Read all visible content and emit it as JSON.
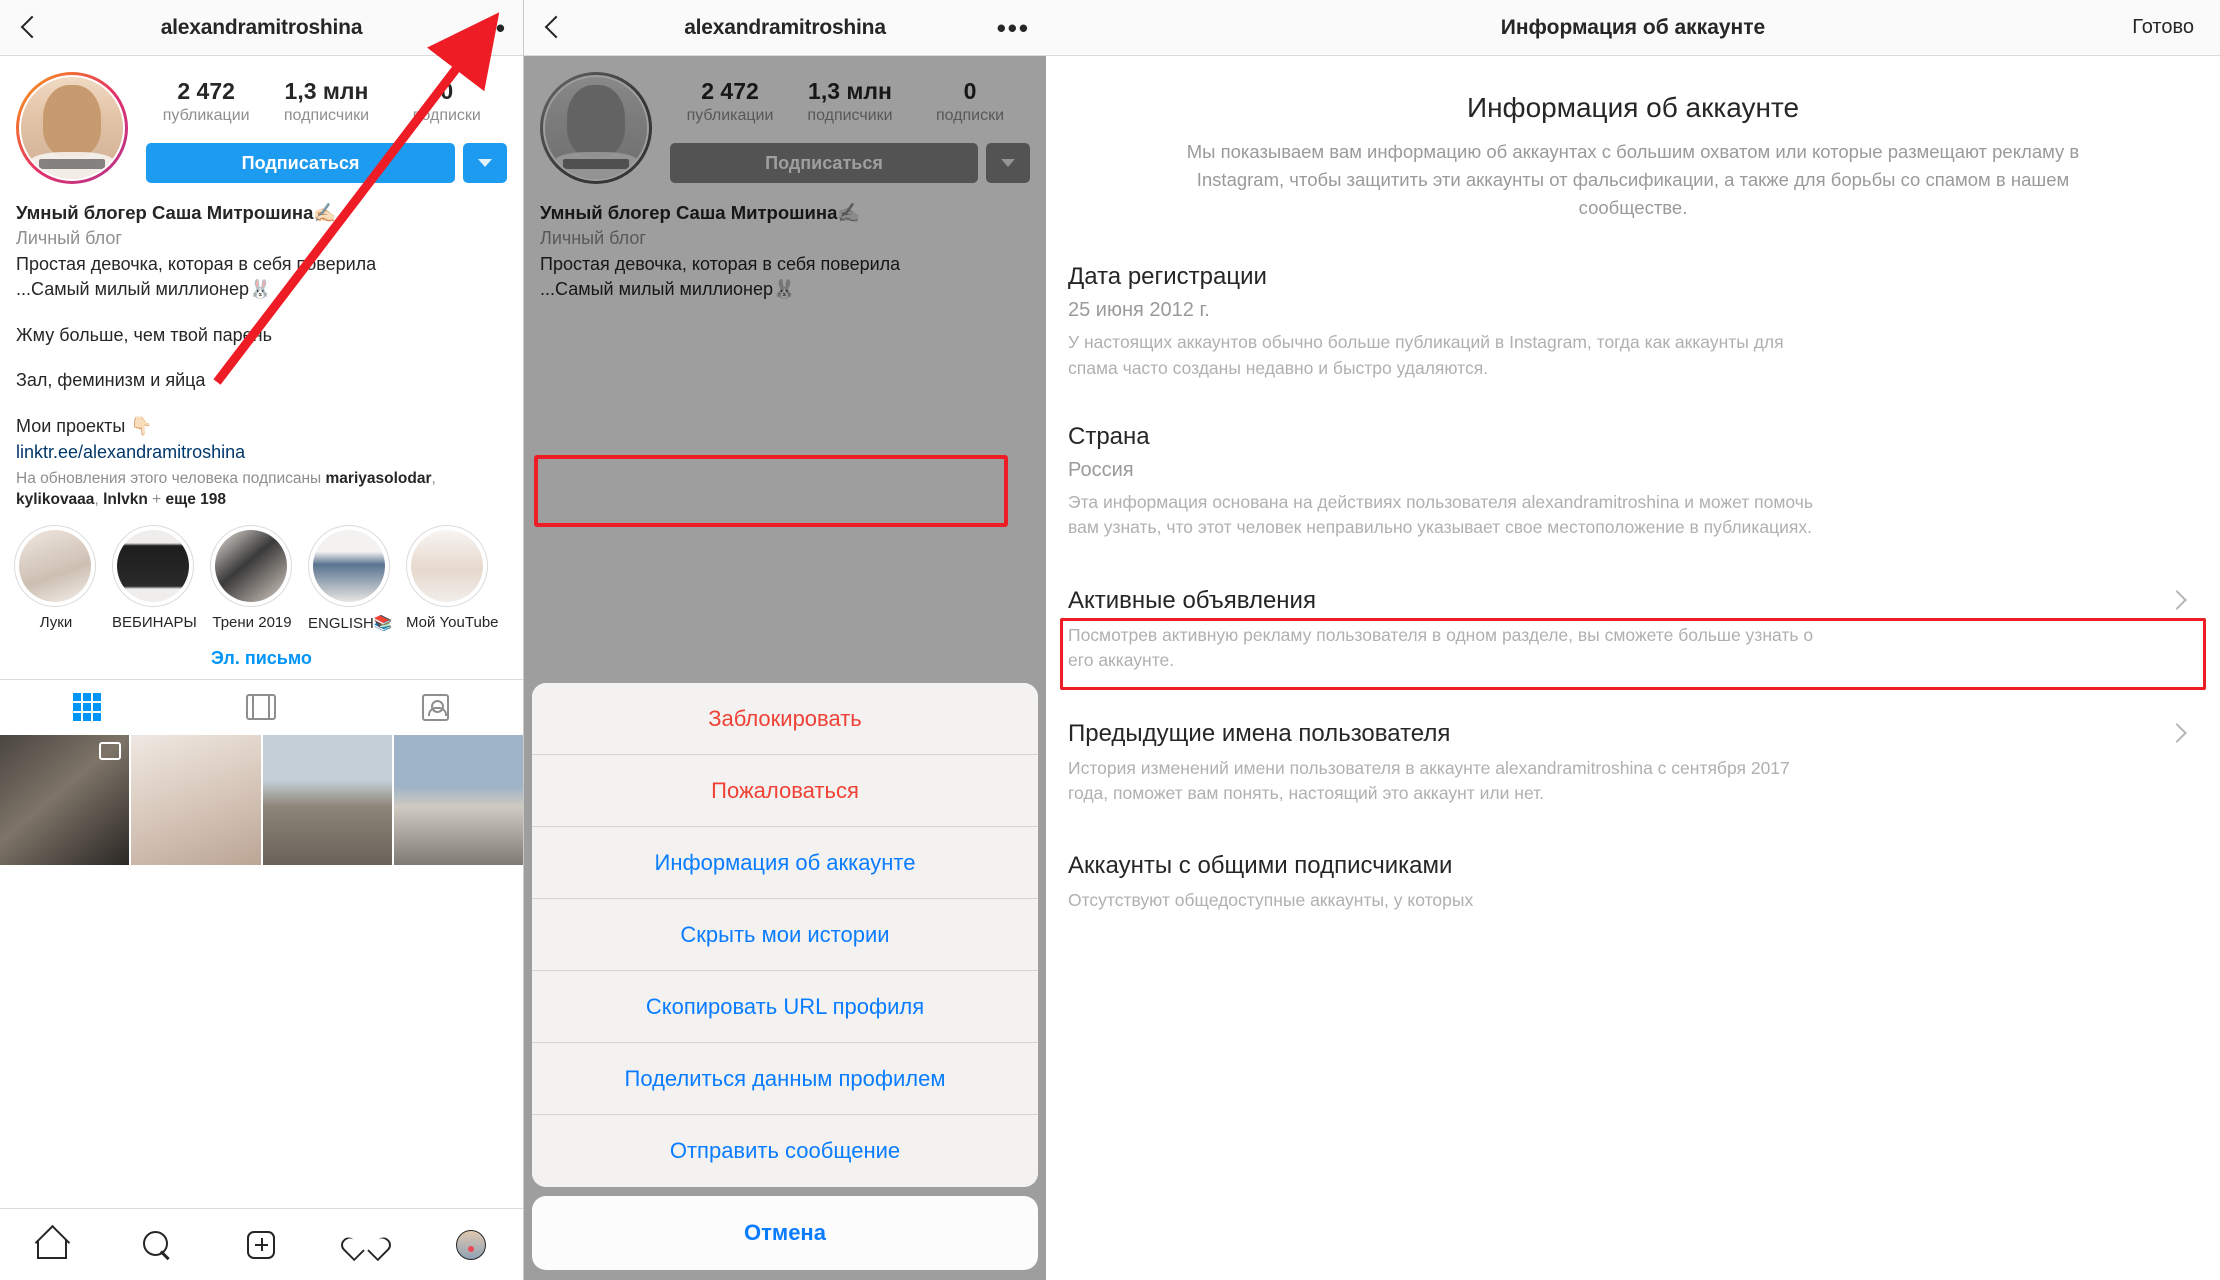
{
  "panel1": {
    "nav": {
      "back_icon": "chevron-left-icon",
      "title": "alexandramitroshina",
      "more_icon": "ellipsis-icon"
    },
    "stats": [
      {
        "num": "2 472",
        "label": "публикации"
      },
      {
        "num": "1,3 млн",
        "label": "подписчики"
      },
      {
        "num": "0",
        "label": "подписки"
      }
    ],
    "follow_button": "Подписаться",
    "bio": {
      "name": "Умный блогер Саша Митрошина✍🏻",
      "category": "Личный блог",
      "line1": "Простая девочка, которая в себя поверила",
      "line2": "...Самый милый миллионер🐰",
      "line3": "Жму больше, чем твой парень",
      "line4": "Зал, феминизм и яйца",
      "line5": "Мои проекты 👇🏻",
      "link": "linktr.ee/alexandramitroshina"
    },
    "followed_by": {
      "prefix": "На обновления этого человека подписаны ",
      "name1": "mariyasolodar",
      "sep1": ", ",
      "name2": "kylikovaaa",
      "sep2": ", ",
      "name3": "lnlvkn",
      "plus": " + ",
      "more": "еще 198"
    },
    "highlights": [
      {
        "label": "Луки"
      },
      {
        "label": "ВЕБИНАРЫ"
      },
      {
        "label": "Трени 2019"
      },
      {
        "label": "ENGLISH📚"
      },
      {
        "label": "Мой YouTube"
      }
    ],
    "email_button": "Эл. письмо",
    "tabs": [
      {
        "icon": "grid-icon",
        "active": true
      },
      {
        "icon": "carousel-icon",
        "active": false
      },
      {
        "icon": "tagged-icon",
        "active": false
      }
    ],
    "bottom_nav": [
      {
        "icon": "home-icon"
      },
      {
        "icon": "search-icon"
      },
      {
        "icon": "add-post-icon"
      },
      {
        "icon": "heart-icon"
      },
      {
        "icon": "profile-avatar-icon"
      }
    ]
  },
  "panel2": {
    "nav": {
      "back_icon": "chevron-left-icon",
      "title": "alexandramitroshina",
      "more_icon": "ellipsis-icon"
    },
    "stats": [
      {
        "num": "2 472",
        "label": "публикации"
      },
      {
        "num": "1,3 млн",
        "label": "подписчики"
      },
      {
        "num": "0",
        "label": "подписки"
      }
    ],
    "follow_button": "Подписаться",
    "bio": {
      "name": "Умный блогер Саша Митрошина✍🏻",
      "category": "Личный блог",
      "line1": "Простая девочка, которая в себя поверила",
      "line2": "...Самый милый миллионер🐰"
    },
    "action_sheet": {
      "items": [
        {
          "label": "Заблокировать",
          "style": "danger"
        },
        {
          "label": "Пожаловаться",
          "style": "danger"
        },
        {
          "label": "Информация об аккаунте",
          "style": "normal",
          "highlighted": true
        },
        {
          "label": "Скрыть мои истории",
          "style": "normal"
        },
        {
          "label": "Скопировать URL профиля",
          "style": "normal"
        },
        {
          "label": "Поделиться данным профилем",
          "style": "normal"
        },
        {
          "label": "Отправить сообщение",
          "style": "normal"
        }
      ],
      "cancel": "Отмена"
    }
  },
  "panel3": {
    "nav": {
      "title": "Информация об аккаунте",
      "done": "Готово"
    },
    "hero": {
      "title": "Информация об аккаунте",
      "description": "Мы показываем вам информацию об аккаунтах с большим охватом или которые размещают рекламу в Instagram, чтобы защитить эти аккаунты от фальсификации, а также для борьбы со спамом в нашем сообществе."
    },
    "sections": [
      {
        "title": "Дата регистрации",
        "value": "25 июня 2012 г.",
        "description": "У настоящих аккаунтов обычно больше публикаций в Instagram, тогда как аккаунты для спама часто созданы недавно и быстро удаляются.",
        "chevron": false,
        "highlighted": false
      },
      {
        "title": "Страна",
        "value": "Россия",
        "description": "Эта информация основана на действиях пользователя alexandramitroshina и может помочь вам узнать, что этот человек неправильно указывает свое местоположение в публикациях.",
        "chevron": false,
        "highlighted": false
      },
      {
        "title": "Активные объявления",
        "value": "",
        "description": "Посмотрев активную рекламу пользователя в одном разделе, вы сможете больше узнать о его аккаунте.",
        "chevron": true,
        "highlighted": true
      },
      {
        "title": "Предыдущие имена пользователя",
        "value": "",
        "description": "История изменений имени пользователя в аккаунте alexandramitroshina с сентября 2017 года, поможет вам понять, настоящий это аккаунт или нет.",
        "chevron": true,
        "highlighted": false
      },
      {
        "title": "Аккаунты с общими подписчиками",
        "value": "",
        "description": "Отсутствуют общедоступные аккаунты, у которых",
        "chevron": false,
        "highlighted": false
      }
    ]
  },
  "annotation": {
    "arrow_color": "#ee1c25",
    "highlight_color": "#ee1c25"
  }
}
